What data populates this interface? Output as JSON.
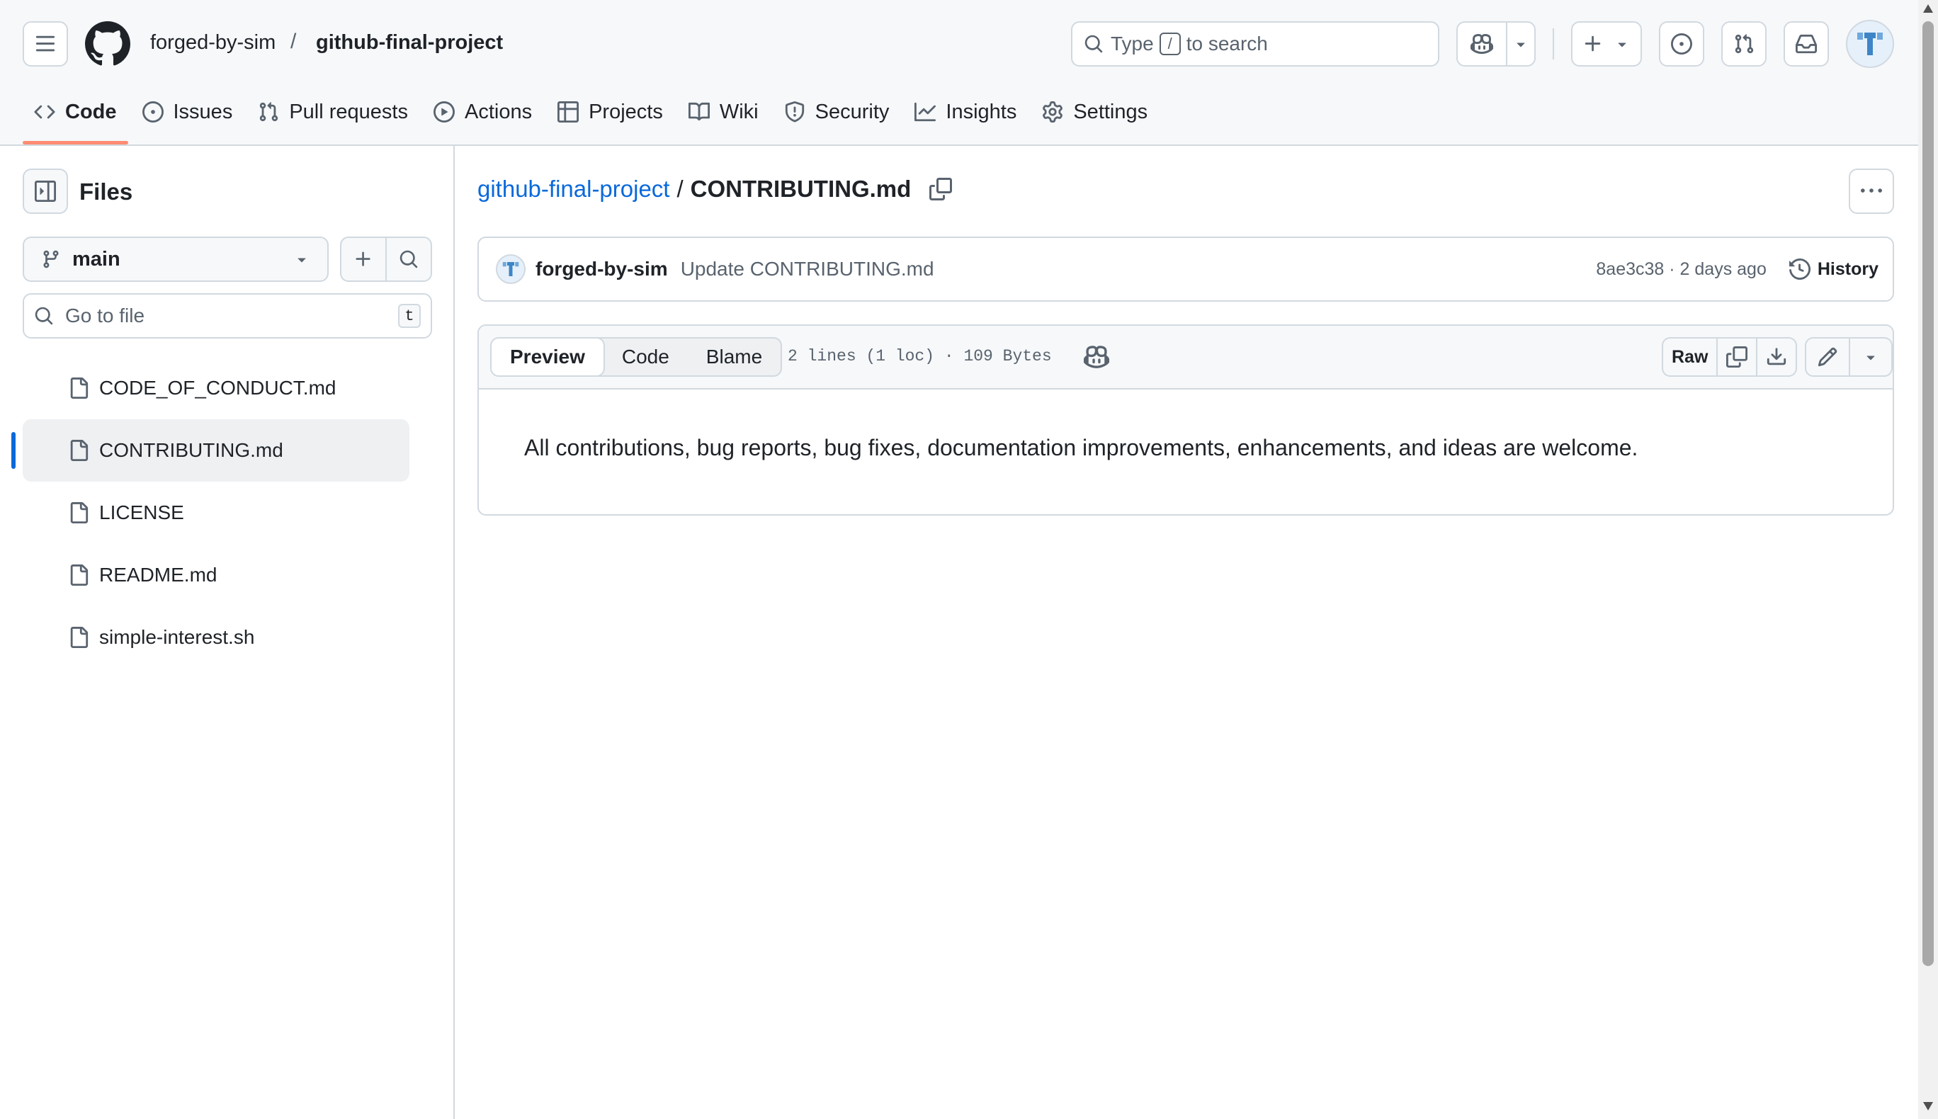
{
  "header": {
    "owner": "forged-by-sim",
    "separator": "/",
    "repo": "github-final-project",
    "search": {
      "prefix": "Type",
      "key": "/",
      "suffix": "to search"
    },
    "icons": [
      "menu-icon",
      "github-logo-icon",
      "search-icon",
      "copilot-icon",
      "plus-icon",
      "issue-opened-icon",
      "git-pull-request-icon",
      "inbox-icon"
    ]
  },
  "repo_nav": {
    "tabs": [
      {
        "label": "Code",
        "icon": "code-icon",
        "active": true
      },
      {
        "label": "Issues",
        "icon": "issue-opened-icon"
      },
      {
        "label": "Pull requests",
        "icon": "git-pull-request-icon"
      },
      {
        "label": "Actions",
        "icon": "play-icon"
      },
      {
        "label": "Projects",
        "icon": "table-icon"
      },
      {
        "label": "Wiki",
        "icon": "book-icon"
      },
      {
        "label": "Security",
        "icon": "shield-icon"
      },
      {
        "label": "Insights",
        "icon": "graph-icon"
      },
      {
        "label": "Settings",
        "icon": "gear-icon"
      }
    ],
    "active_color": "#fd8c73"
  },
  "sidebar": {
    "title": "Files",
    "branch": "main",
    "goto_placeholder": "Go to file",
    "goto_shortcut": "t",
    "files": [
      {
        "name": "CODE_OF_CONDUCT.md"
      },
      {
        "name": "CONTRIBUTING.md",
        "selected": true
      },
      {
        "name": "LICENSE"
      },
      {
        "name": "README.md"
      },
      {
        "name": "simple-interest.sh"
      }
    ]
  },
  "main": {
    "breadcrumb": {
      "repo": "github-final-project",
      "separator": "/",
      "file": "CONTRIBUTING.md"
    },
    "commit": {
      "author": "forged-by-sim",
      "message": "Update CONTRIBUTING.md",
      "meta": "8ae3c38 · 2 days ago",
      "history_label": "History"
    },
    "file_view": {
      "tabs": [
        "Preview",
        "Code",
        "Blame"
      ],
      "active_tab": "Preview",
      "stats": "2 lines (1 loc) · 109 Bytes",
      "raw_label": "Raw",
      "content": "All contributions, bug reports, bug fixes, documentation improvements, enhancements, and ideas are welcome."
    }
  },
  "colors": {
    "link": "#0969da",
    "border": "#d1d9e0",
    "muted": "#59636e",
    "selected_indicator": "#0969da"
  }
}
